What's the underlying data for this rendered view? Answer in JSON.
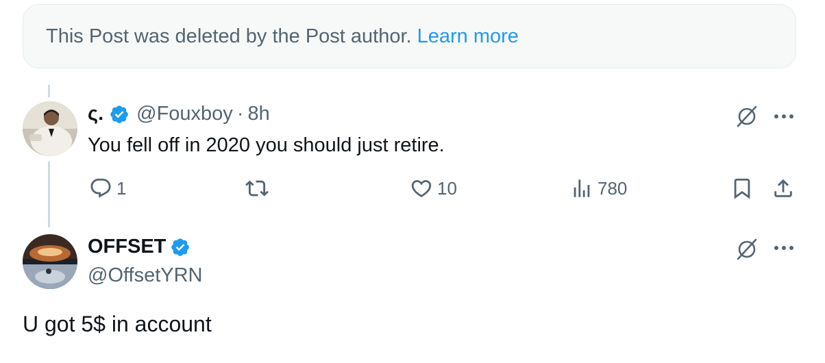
{
  "deleted_notice": {
    "text": "This Post was deleted by the Post author.",
    "link": "Learn more"
  },
  "reply": {
    "name": "ς.",
    "handle": "@Fouxboy",
    "separator": "·",
    "time": "8h",
    "text": "You fell off in 2020 you should just retire.",
    "replies": "1",
    "likes": "10",
    "views": "780"
  },
  "main_post": {
    "name": "OFFSET",
    "handle": "@OffsetYRN",
    "text": "U got 5$ in account"
  },
  "colors": {
    "accent": "#1d9bf0",
    "secondary_text": "#536471",
    "primary_text": "#0f1419",
    "notice_bg": "#f7f9f9"
  },
  "icons": [
    "verified-badge-icon",
    "grok-icon",
    "more-icon",
    "reply-icon",
    "repost-icon",
    "like-icon",
    "views-icon",
    "bookmark-icon",
    "share-icon"
  ]
}
